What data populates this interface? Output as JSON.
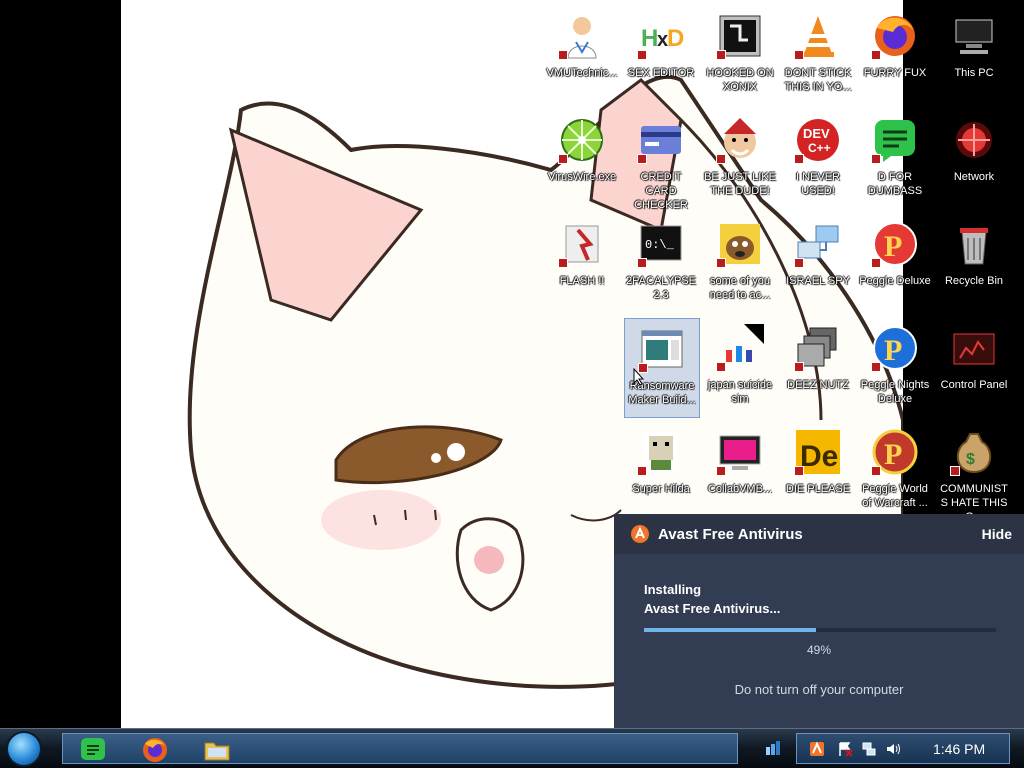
{
  "desktop": {
    "icons": [
      {
        "label": "VMUTechnic...",
        "icon": "doctor-person-icon",
        "selected": false
      },
      {
        "label": "SEX EDITOR",
        "icon": "hxd-editor-icon",
        "selected": false
      },
      {
        "label": "HOOKED ON XONIX",
        "icon": "xonix-game-icon",
        "selected": false
      },
      {
        "label": "DONT STICK THIS IN YO...",
        "icon": "vlc-cone-icon",
        "selected": false
      },
      {
        "label": "FURRY FUX",
        "icon": "firefox-icon",
        "selected": false
      },
      {
        "label": "This PC",
        "icon": "computer-icon",
        "selected": false
      },
      {
        "label": "VirusWire.exe",
        "icon": "lime-disc-icon",
        "selected": false
      },
      {
        "label": "CREDIT CARD CHECKER",
        "icon": "credit-card-icon",
        "selected": false
      },
      {
        "label": "BE JUST LIKE THE DUDE!",
        "icon": "elf-face-icon",
        "selected": false
      },
      {
        "label": "I NEVER USED!",
        "icon": "devcpp-icon",
        "selected": false
      },
      {
        "label": "D FOR DUMBASS",
        "icon": "green-chat-icon",
        "selected": false
      },
      {
        "label": "Network",
        "icon": "network-orb-icon",
        "selected": false
      },
      {
        "label": "FLASH !!",
        "icon": "flash-icon",
        "selected": false
      },
      {
        "label": "2PACALYPSE 2.3",
        "icon": "terminal-icon",
        "selected": false
      },
      {
        "label": "some of you need to ac...",
        "icon": "scooby-dog-icon",
        "selected": false
      },
      {
        "label": "ISRAEL SPY",
        "icon": "network-pc-icon",
        "selected": false
      },
      {
        "label": "Peggle Deluxe",
        "icon": "peggle-icon",
        "selected": false
      },
      {
        "label": "Recycle Bin",
        "icon": "recycle-bin-icon",
        "selected": false
      },
      {
        "label": "Ransomware Maker Build...",
        "icon": "window-app-icon",
        "selected": true
      },
      {
        "label": "japan suicide sim",
        "icon": "pixel-figures-icon",
        "selected": false
      },
      {
        "label": "DEEZ NUTZ",
        "icon": "stacked-windows-icon",
        "selected": false
      },
      {
        "label": "Peggle Nights Deluxe",
        "icon": "peggle-nights-icon",
        "selected": false
      },
      {
        "label": "Control Panel",
        "icon": "control-panel-icon",
        "selected": false
      },
      {
        "label": "Super Hilda",
        "icon": "pixel-hilda-icon",
        "selected": false
      },
      {
        "label": "CollabVMB...",
        "icon": "pink-monitor-icon",
        "selected": false
      },
      {
        "label": "DIE PLEASE",
        "icon": "de-letters-icon",
        "selected": false
      },
      {
        "label": "Peggle World of Warcraft ...",
        "icon": "peggle-wow-icon",
        "selected": false
      },
      {
        "label": "COMMUNISTS HATE THIS G...",
        "icon": "money-bag-icon",
        "selected": false
      }
    ]
  },
  "avast": {
    "title": "Avast Free Antivirus",
    "hide_label": "Hide",
    "status_line1": "Installing",
    "status_line2": "Avast Free Antivirus...",
    "progress": 0.49,
    "progress_text": "49%",
    "note": "Do not turn off your computer",
    "accent": "#f0742a"
  },
  "taskbar": {
    "start_icon": "windows-orb-icon",
    "pinned": [
      {
        "name": "green-chat-icon"
      },
      {
        "name": "firefox-icon"
      },
      {
        "name": "folder-icon"
      }
    ],
    "tray_icons": [
      "avast-tray-icon",
      "action-center-flag-icon",
      "network-tray-icon",
      "volume-icon"
    ],
    "clock": "1:46 PM"
  }
}
